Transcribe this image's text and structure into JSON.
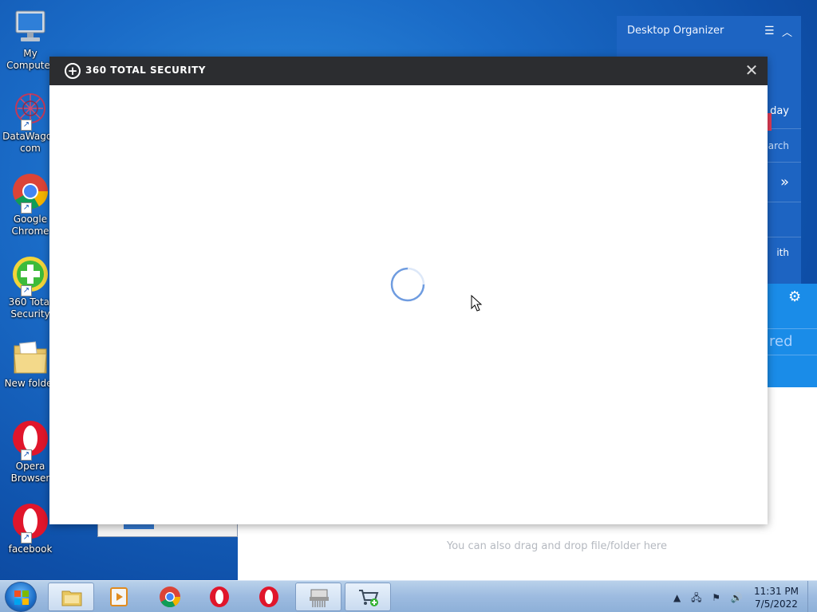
{
  "desktop": {
    "icons": [
      {
        "label": "My\nComputer",
        "line1": "My",
        "line2": "Computer"
      },
      {
        "line1": "DataWagon",
        "line2": "com"
      },
      {
        "line1": "Google",
        "line2": "Chrome"
      },
      {
        "line1": "360 Total",
        "line2": "Security"
      },
      {
        "line1": "New folder",
        "line2": ""
      },
      {
        "line1": "Opera",
        "line2": "Browser"
      },
      {
        "line1": "facebook",
        "line2": ""
      }
    ]
  },
  "organizer": {
    "title": "Desktop Organizer",
    "partial_texts": [
      "day",
      "arch",
      "ith"
    ],
    "partial_red": "red"
  },
  "background_window": {
    "hint": "You can also drag and drop file/folder here"
  },
  "popup": {
    "title": "360 TOTAL SECURITY",
    "close_glyph": "✕"
  },
  "taskbar": {
    "items": [
      "file-explorer",
      "media-player",
      "google-chrome",
      "opera",
      "opera",
      "shredder",
      "cart-add"
    ],
    "clock_time": "11:31 PM",
    "clock_date": "7/5/2022"
  }
}
